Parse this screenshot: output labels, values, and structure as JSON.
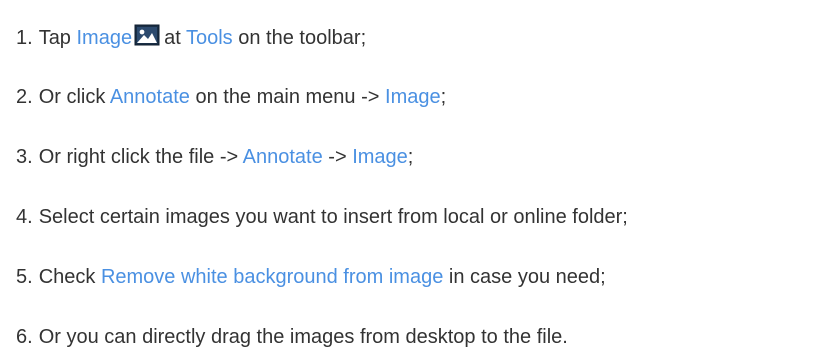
{
  "colors": {
    "text": "#333333",
    "link": "#4a90e2",
    "background": "#ffffff"
  },
  "steps": [
    {
      "num": "1.",
      "parts": [
        "Tap",
        "Image",
        "at",
        "Tools",
        "on the toolbar;"
      ],
      "icon": "image-icon"
    },
    {
      "num": "2.",
      "parts": [
        "Or click",
        "Annotate",
        "on the main menu ->",
        "Image",
        ";"
      ]
    },
    {
      "num": "3.",
      "parts": [
        "Or right click the file ->",
        "Annotate",
        "->",
        "Image",
        ";"
      ]
    },
    {
      "num": "4.",
      "parts": [
        "Select certain images you want to insert from local or online folder;"
      ]
    },
    {
      "num": "5.",
      "parts": [
        "Check",
        "Remove white background from image",
        "in case you need;"
      ]
    },
    {
      "num": "6.",
      "parts": [
        "Or you can directly drag the images from desktop to the file."
      ]
    }
  ]
}
